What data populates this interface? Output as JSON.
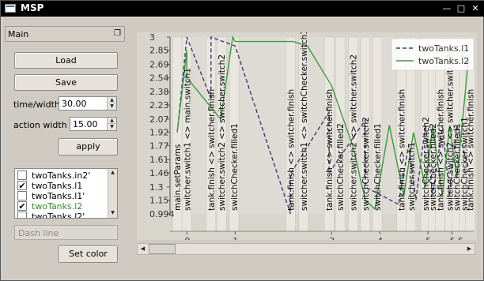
{
  "window": {
    "title": "MSP"
  },
  "panel": {
    "title": "Main",
    "load_label": "Load",
    "save_label": "Save",
    "time_width_label": "time/width",
    "time_width_value": "30.00",
    "action_width_label": "action width",
    "action_width_value": "15.00",
    "apply_label": "apply",
    "list_items": [
      {
        "label": "twoTanks.in2'",
        "checked": false,
        "color": "#000000"
      },
      {
        "label": "twoTanks.l1",
        "checked": true,
        "color": "#000000"
      },
      {
        "label": "twoTanks.l1'",
        "checked": false,
        "color": "#000000"
      },
      {
        "label": "twoTanks.l2",
        "checked": true,
        "color": "#2e8b2e"
      },
      {
        "label": "twoTanks.l2'",
        "checked": false,
        "color": "#000000"
      }
    ],
    "dash_line_placeholder": "Dash line",
    "set_color_label": "Set color"
  },
  "chart_data": {
    "type": "line",
    "y_ticks": [
      "3",
      "2.85",
      "2.69",
      "2.54",
      "2.38",
      "2.23",
      "2.07",
      "1.92",
      "1.77",
      "1.61",
      "1.46",
      "1.3",
      "1.15",
      "0.994"
    ],
    "x_ticks": [
      "0",
      "1",
      "3",
      "4",
      "5",
      "5.5"
    ],
    "ylim": [
      0.994,
      3
    ],
    "legend": {
      "placement": "top-right",
      "entries": [
        {
          "name": "twoTanks.l1",
          "style": "dashed",
          "color": "#3c3c6e"
        },
        {
          "name": "twoTanks.l2",
          "style": "solid",
          "color": "#3c9a3c"
        }
      ]
    },
    "event_labels": [
      {
        "x": -0.2,
        "label": "main.setParams"
      },
      {
        "x": 0.0,
        "label": "switcher.switch1 <> main.switch1"
      },
      {
        "x": 0.5,
        "label": "tank.finish <> switcher.finish"
      },
      {
        "x": 0.72,
        "label": "switcher.switch2 <> switcher.switch2"
      },
      {
        "x": 0.98,
        "label": "switchChecker.filled1"
      },
      {
        "x": 2.15,
        "label": "tank.finish <> switcher.finish"
      },
      {
        "x": 2.42,
        "label": "switcher.switch1 <> switchChecker.switch1"
      },
      {
        "x": 2.95,
        "label": "tank.finish <> switcher.finish"
      },
      {
        "x": 3.18,
        "label": "switchChecker.filled2"
      },
      {
        "x": 3.45,
        "label": "switcher.switch2 <> switcher.switch2"
      },
      {
        "x": 3.7,
        "label": "switchChecker.switch2"
      },
      {
        "x": 3.95,
        "label": "switchChecker.filled1"
      },
      {
        "x": 4.45,
        "label": "tank.finish <> switcher.finish"
      },
      {
        "x": 4.65,
        "label": "switcher.switch1"
      },
      {
        "x": 4.95,
        "label": "switchChecker.switch2"
      },
      {
        "x": 5.1,
        "label": "switchChecker.filled2"
      },
      {
        "x": 5.25,
        "label": "tank.finish <> switcher.finish"
      },
      {
        "x": 5.45,
        "label": "switcher.switch2 <> switcher.switch2"
      },
      {
        "x": 5.6,
        "label": "switchChecker.filled1"
      },
      {
        "x": 5.75,
        "label": "switchChecker.switch1"
      },
      {
        "x": 5.88,
        "label": "tank.finish <> switcher.finish"
      }
    ],
    "series": [
      {
        "name": "twoTanks.l1",
        "x": [
          -0.2,
          0.0,
          0.5,
          0.5,
          1.0,
          2.15,
          2.15,
          2.95,
          2.95,
          3.7,
          3.7,
          4.4,
          4.4,
          4.6,
          4.75,
          4.95,
          5.1,
          5.3,
          5.45,
          5.6,
          5.85
        ],
        "values": [
          1.92,
          3.0,
          2.3,
          3.0,
          2.9,
          0.994,
          1.45,
          2.15,
          1.46,
          2.06,
          1.3,
          1.1,
          1.15,
          1.77,
          1.15,
          2.0,
          1.2,
          2.0,
          1.2,
          2.0,
          1.5
        ]
      },
      {
        "name": "twoTanks.l2",
        "x": [
          -0.2,
          0.0,
          0.0,
          0.7,
          0.95,
          1.0,
          2.2,
          2.5,
          3.0,
          3.45,
          3.7,
          3.9,
          4.2,
          4.5,
          4.7,
          4.95,
          5.1,
          5.3,
          5.45,
          5.6,
          5.85
        ],
        "values": [
          1.92,
          2.85,
          2.54,
          2.07,
          3.0,
          2.95,
          2.95,
          2.9,
          2.45,
          1.75,
          1.15,
          1.05,
          2.0,
          1.2,
          1.92,
          1.3,
          2.0,
          1.2,
          2.0,
          1.4,
          2.8
        ]
      }
    ]
  }
}
